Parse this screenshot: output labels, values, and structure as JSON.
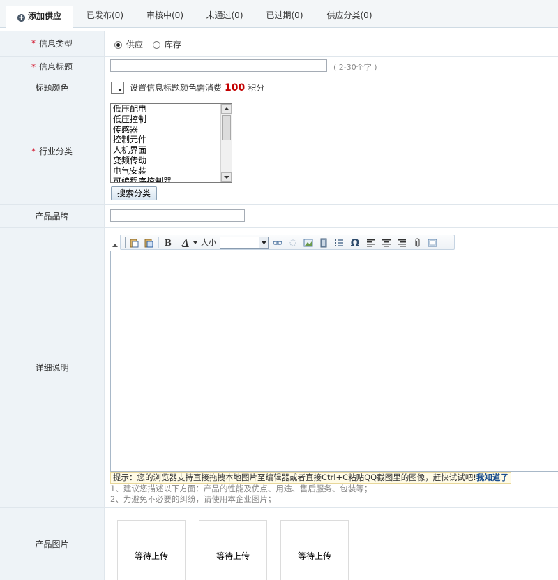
{
  "tabs": [
    {
      "label": "添加供应",
      "active": true
    },
    {
      "label": "已发布(0)"
    },
    {
      "label": "审核中(0)"
    },
    {
      "label": "未通过(0)"
    },
    {
      "label": "已过期(0)"
    },
    {
      "label": "供应分类(0)"
    }
  ],
  "form": {
    "info_type": {
      "label": "信息类型",
      "options": [
        "供应",
        "库存"
      ],
      "selected": "供应"
    },
    "info_title": {
      "label": "信息标题",
      "value": "",
      "hint": "( 2-30个字 )"
    },
    "title_color": {
      "label": "标题颜色",
      "text_before": "设置信息标题颜色需消费",
      "points": "100",
      "text_after": "积分"
    },
    "industry": {
      "label": "行业分类",
      "options": [
        "低压配电",
        "低压控制",
        "传感器",
        "控制元件",
        "人机界面",
        "变频传动",
        "电气安装",
        "可编程序控制器"
      ],
      "search_button": "搜索分类"
    },
    "brand": {
      "label": "产品品牌",
      "value": ""
    },
    "detail": {
      "label": "详细说明",
      "toolbar": {
        "size_label": "大小"
      },
      "tip_text": "提示：您的浏览器支持直接拖拽本地图片至编辑器或者直接Ctrl+C粘贴QQ截图里的图像，赶快试试吧!",
      "tip_link": "我知道了",
      "notes": [
        "1、建议您描述以下方面：产品的性能及优点、用途、售后服务、包装等；",
        "2、为避免不必要的纠纷，请使用本企业图片；"
      ]
    },
    "images": {
      "label": "产品图片",
      "slots": [
        "等待上传",
        "等待上传",
        "等待上传"
      ]
    }
  },
  "colors": {
    "required_star": "#d0021b",
    "points": "#c30000",
    "label_bg": "#eef3f7"
  }
}
